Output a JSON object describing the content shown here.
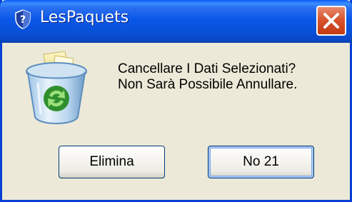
{
  "window": {
    "title": "LesPaquets",
    "title_icon": "shield-help-icon",
    "close_icon": "close-icon"
  },
  "dialog": {
    "icon": "recycle-bin-icon",
    "message_lines": [
      "Cancellare I Dati Selezionati?",
      "Non Sarà Possibile Annullare."
    ]
  },
  "buttons": {
    "delete_label": "Elimina",
    "no_label": "No 21"
  },
  "colors": {
    "titlebar": "#0a58e8",
    "dialog_bg": "#ece9d8",
    "close_button": "#d9542f"
  }
}
